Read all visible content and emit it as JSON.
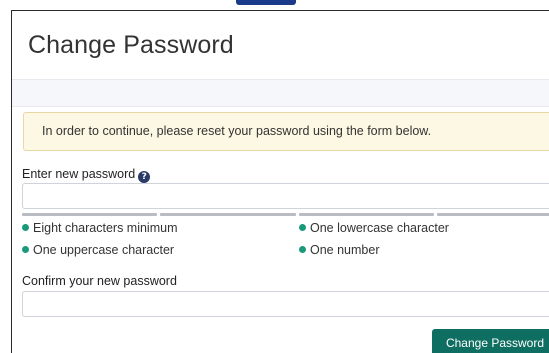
{
  "card": {
    "title": "Change Password"
  },
  "notice": {
    "text": "In order to continue, please reset your password using the form below."
  },
  "new_password": {
    "label": "Enter new password",
    "help_icon": "question-circle-icon",
    "value": "",
    "placeholder": ""
  },
  "requirements": [
    {
      "text": "Eight characters minimum"
    },
    {
      "text": "One lowercase character"
    },
    {
      "text": "One uppercase character"
    },
    {
      "text": "One number"
    }
  ],
  "confirm_password": {
    "label": "Confirm your new password",
    "value": "",
    "placeholder": ""
  },
  "submit": {
    "label": "Change Password"
  },
  "colors": {
    "accent": "#1b3a8a",
    "button": "#0f6e62",
    "requirement_dot": "#1a9a7b",
    "notice_background": "#fcf8e3",
    "strength_bar": "#b9bcc2"
  }
}
